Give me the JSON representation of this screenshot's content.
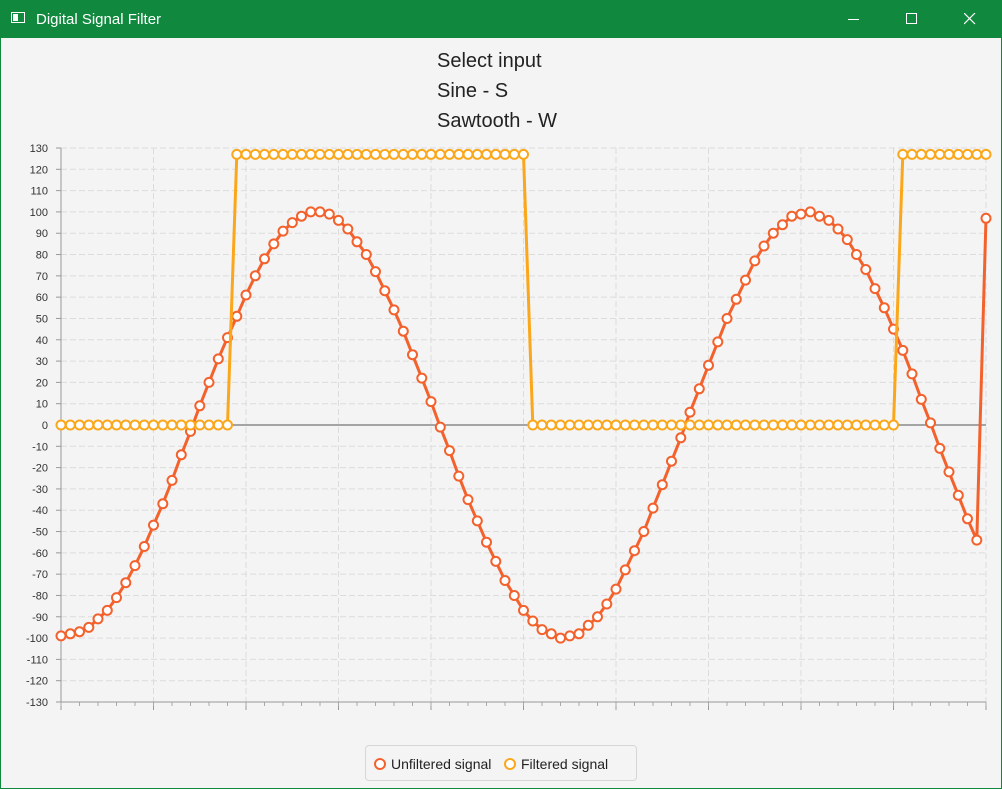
{
  "window": {
    "title": "Digital Signal Filter",
    "accent_color": "#10893e",
    "controls": [
      "minimize-icon",
      "maximize-icon",
      "close-icon"
    ]
  },
  "header": {
    "line1": "Select input",
    "line2": "Sine - S",
    "line3": "Sawtooth - W"
  },
  "chart_data": {
    "type": "line",
    "title": "",
    "xlabel": "",
    "ylabel": "",
    "xlim": [
      0,
      200
    ],
    "ylim": [
      -130,
      130
    ],
    "ytick_step": 10,
    "yticks": [
      "130",
      "120",
      "110",
      "100",
      "90",
      "80",
      "70",
      "60",
      "50",
      "40",
      "30",
      "20",
      "10",
      "0",
      "-10",
      "-20",
      "-30",
      "-40",
      "-50",
      "-60",
      "-70",
      "-80",
      "-90",
      "-100",
      "-110",
      "-120",
      "-130"
    ],
    "grid": true,
    "legend_position": "bottom-center",
    "series": [
      {
        "name": "Unfiltered signal",
        "color": "#f3622d",
        "marker": "hollow-circle",
        "x": [
          0,
          2,
          4,
          6,
          8,
          10,
          12,
          14,
          16,
          18,
          20,
          22,
          24,
          26,
          28,
          30,
          32,
          34,
          36,
          38,
          40,
          42,
          44,
          46,
          48,
          50,
          52,
          54,
          56,
          58,
          60,
          62,
          64,
          66,
          68,
          70,
          72,
          74,
          76,
          78,
          80,
          82,
          84,
          86,
          88,
          90,
          92,
          94,
          96,
          98,
          100,
          102,
          104,
          106,
          108,
          110,
          112,
          114,
          116,
          118,
          120,
          122,
          124,
          126,
          128,
          130,
          132,
          134,
          136,
          138,
          140,
          142,
          144,
          146,
          148,
          150,
          152,
          154,
          156,
          158,
          160,
          162,
          164,
          166,
          168,
          170,
          172,
          174,
          176,
          178,
          180,
          182,
          184,
          186,
          188,
          190,
          192,
          194,
          196,
          198,
          200
        ],
        "y": [
          -99,
          -98,
          -97,
          -95,
          -91,
          -87,
          -81,
          -74,
          -66,
          -57,
          -47,
          -37,
          -26,
          -14,
          -3,
          9,
          20,
          31,
          41,
          51,
          61,
          70,
          78,
          85,
          91,
          95,
          98,
          100,
          100,
          99,
          96,
          92,
          86,
          80,
          72,
          63,
          54,
          44,
          33,
          22,
          11,
          -1,
          -12,
          -24,
          -35,
          -45,
          -55,
          -64,
          -73,
          -80,
          -87,
          -92,
          -96,
          -98,
          -100,
          -99,
          -98,
          -94,
          -90,
          -84,
          -77,
          -68,
          -59,
          -50,
          -39,
          -28,
          -17,
          -6,
          6,
          17,
          28,
          39,
          50,
          59,
          68,
          77,
          84,
          90,
          94,
          98,
          99,
          100,
          98,
          96,
          92,
          87,
          80,
          73,
          64,
          55,
          45,
          35,
          24,
          12,
          1,
          -11,
          -22,
          -33,
          -44,
          -54,
          97
        ]
      },
      {
        "name": "Filtered signal",
        "color": "#fba71b",
        "marker": "hollow-circle",
        "x": [
          0,
          2,
          4,
          6,
          8,
          10,
          12,
          14,
          16,
          18,
          20,
          22,
          24,
          26,
          28,
          30,
          32,
          34,
          36,
          38,
          40,
          42,
          44,
          46,
          48,
          50,
          52,
          54,
          56,
          58,
          60,
          62,
          64,
          66,
          68,
          70,
          72,
          74,
          76,
          78,
          80,
          82,
          84,
          86,
          88,
          90,
          92,
          94,
          96,
          98,
          100,
          102,
          104,
          106,
          108,
          110,
          112,
          114,
          116,
          118,
          120,
          122,
          124,
          126,
          128,
          130,
          132,
          134,
          136,
          138,
          140,
          142,
          144,
          146,
          148,
          150,
          152,
          154,
          156,
          158,
          160,
          162,
          164,
          166,
          168,
          170,
          172,
          174,
          176,
          178,
          180,
          182,
          184,
          186,
          188,
          190,
          192,
          194,
          196,
          198,
          200
        ],
        "y": [
          0,
          0,
          0,
          0,
          0,
          0,
          0,
          0,
          0,
          0,
          0,
          0,
          0,
          0,
          0,
          0,
          0,
          0,
          0,
          127,
          127,
          127,
          127,
          127,
          127,
          127,
          127,
          127,
          127,
          127,
          127,
          127,
          127,
          127,
          127,
          127,
          127,
          127,
          127,
          127,
          127,
          127,
          127,
          127,
          127,
          127,
          127,
          127,
          127,
          127,
          127,
          0,
          0,
          0,
          0,
          0,
          0,
          0,
          0,
          0,
          0,
          0,
          0,
          0,
          0,
          0,
          0,
          0,
          0,
          0,
          0,
          0,
          0,
          0,
          0,
          0,
          0,
          0,
          0,
          0,
          0,
          0,
          0,
          0,
          0,
          0,
          0,
          0,
          0,
          0,
          0,
          127,
          127,
          127,
          127,
          127,
          127,
          127,
          127,
          127,
          127
        ]
      }
    ]
  }
}
